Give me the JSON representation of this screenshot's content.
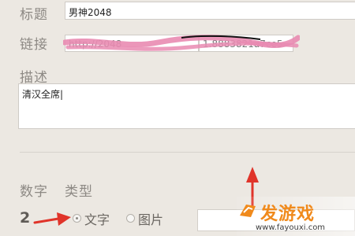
{
  "form": {
    "title_label": "标题",
    "title_value": "男神2048",
    "link_label": "链接",
    "link_value_start": "http://2048",
    "link_value_end": "1.8883821a7ce5",
    "desc_label": "描述",
    "desc_value": "清汉全席|",
    "number_label": "数字",
    "type_label": "类型",
    "number_value": "2",
    "type_options": [
      "文字",
      "图片"
    ],
    "type_selected": "文字"
  },
  "watermark": {
    "brand": "发游戏",
    "site": "www.fayouxi.com"
  },
  "colors": {
    "annotation_red": "#e0342a",
    "scribble_pink": "#e98bb1",
    "brand_orange": "#f08a1c"
  }
}
